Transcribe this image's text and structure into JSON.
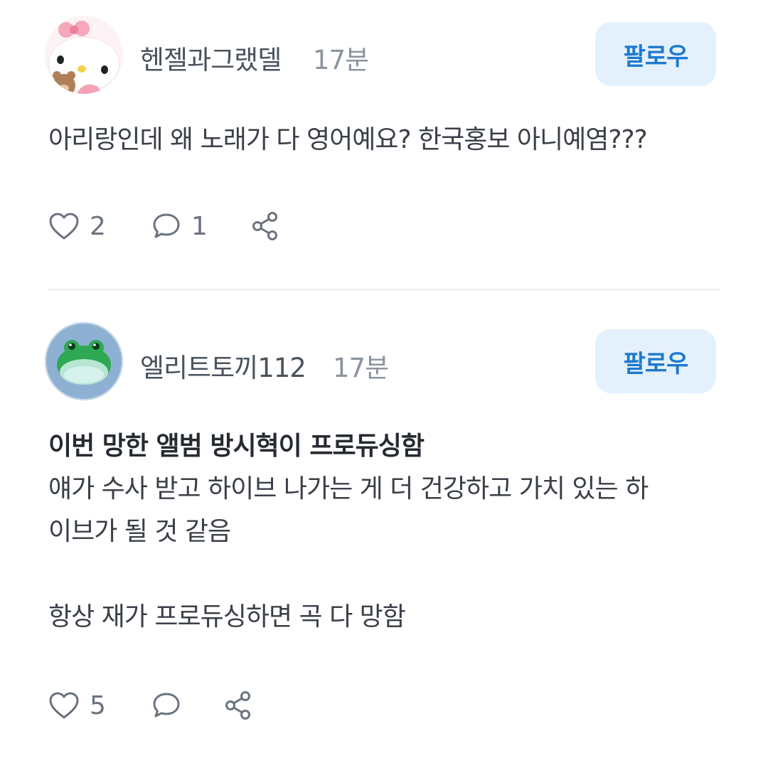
{
  "posts": [
    {
      "username": "헨젤과그랬델",
      "time": "17분",
      "follow_label": "팔로우",
      "avatar_icon": "hello-kitty-avatar",
      "text": "아리랑인데 왜 노래가 다 영어예요? 한국홍보 아니예염???",
      "likes": "2",
      "comments": "1"
    },
    {
      "username": "엘리트토끼112",
      "time": "17분",
      "follow_label": "팔로우",
      "avatar_icon": "frog-avatar",
      "text_bold": "이번 망한 앨범 방시혁이 프로듀싱함",
      "text_line1": "얘가 수사 받고 하이브 나가는 게 더 건강하고 가치 있는 하",
      "text_line2": "이브가 될 것 같음",
      "text_line3": "항상 재가 프로듀싱하면 곡 다 망함",
      "likes": "5"
    }
  ],
  "icons": {
    "like": "heart-icon",
    "comment": "comment-bubble-icon",
    "share": "share-icon"
  },
  "colors": {
    "follow_bg": "#e4f1fd",
    "follow_text": "#1e79cf",
    "icon": "#6b737e"
  }
}
